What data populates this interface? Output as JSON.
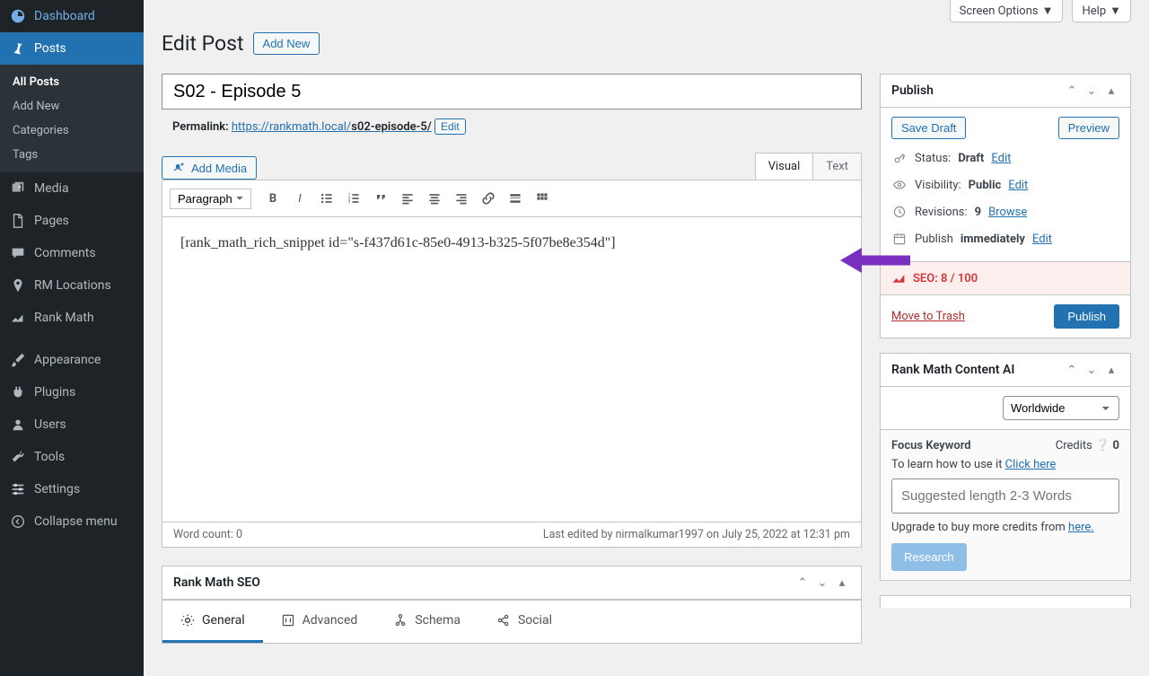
{
  "topbar": {
    "screen_options": "Screen Options",
    "help": "Help"
  },
  "heading": {
    "title": "Edit Post",
    "add_new": "Add New"
  },
  "sidebar": {
    "items": [
      {
        "label": "Dashboard",
        "icon": "dashboard"
      },
      {
        "label": "Posts",
        "icon": "pin"
      },
      {
        "label": "Media",
        "icon": "media"
      },
      {
        "label": "Pages",
        "icon": "page"
      },
      {
        "label": "Comments",
        "icon": "comment"
      },
      {
        "label": "RM Locations",
        "icon": "location"
      },
      {
        "label": "Rank Math",
        "icon": "chart"
      },
      {
        "label": "Appearance",
        "icon": "brush"
      },
      {
        "label": "Plugins",
        "icon": "plug"
      },
      {
        "label": "Users",
        "icon": "user"
      },
      {
        "label": "Tools",
        "icon": "wrench"
      },
      {
        "label": "Settings",
        "icon": "sliders"
      },
      {
        "label": "Collapse menu",
        "icon": "collapse"
      }
    ],
    "posts_sub": [
      "All Posts",
      "Add New",
      "Categories",
      "Tags"
    ]
  },
  "editor": {
    "title_value": "S02 - Episode 5",
    "permalink_label": "Permalink:",
    "permalink_base": "https://rankmath.local/",
    "permalink_slug": "s02-episode-5/",
    "edit": "Edit",
    "add_media": "Add Media",
    "tabs": {
      "visual": "Visual",
      "text": "Text"
    },
    "format": "Paragraph",
    "content": "[rank_math_rich_snippet id=\"s-f437d61c-85e0-4913-b325-5f07be8e354d\"]",
    "word_count": "Word count: 0",
    "last_edited": "Last edited by nirmalkumar1997 on July 25, 2022 at 12:31 pm"
  },
  "publish": {
    "title": "Publish",
    "save_draft": "Save Draft",
    "preview": "Preview",
    "status_label": "Status:",
    "status_value": "Draft",
    "visibility_label": "Visibility:",
    "visibility_value": "Public",
    "revisions_label": "Revisions:",
    "revisions_value": "9",
    "browse": "Browse",
    "publish_label": "Publish",
    "immediately": "immediately",
    "edit": "Edit",
    "seo_label": "SEO:",
    "seo_value": "8 / 100",
    "trash": "Move to Trash",
    "publish_btn": "Publish"
  },
  "content_ai": {
    "title": "Rank Math Content AI",
    "region": "Worldwide",
    "focus": "Focus Keyword",
    "credits_label": "Credits",
    "credits_value": "0",
    "howto": "To learn how to use it ",
    "howto_link": "Click here",
    "placeholder": "Suggested length 2-3 Words",
    "upgrade": "Upgrade to buy more credits from ",
    "upgrade_link": "here.",
    "research": "Research"
  },
  "rm_seo": {
    "title": "Rank Math SEO",
    "tabs": [
      "General",
      "Advanced",
      "Schema",
      "Social"
    ]
  }
}
